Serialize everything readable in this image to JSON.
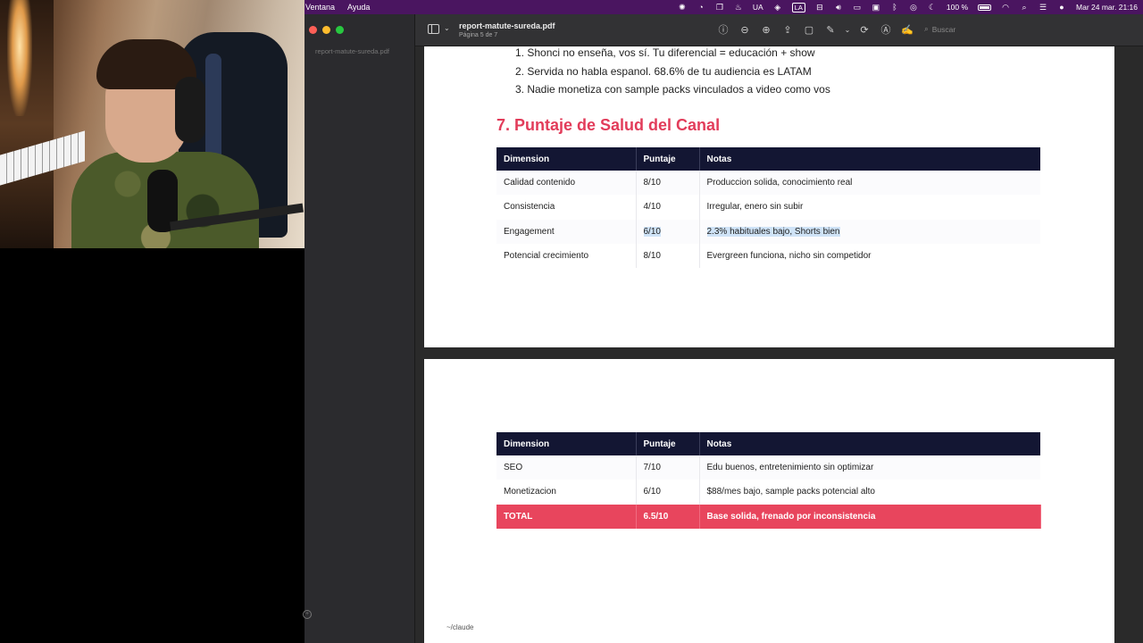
{
  "menubar": {
    "items": [
      "Ventana",
      "Ayuda"
    ],
    "status": {
      "input_source": "UA",
      "keyboard_badge": "LA",
      "battery": "100 %",
      "datetime": "Mar 24 mar.  21:16"
    }
  },
  "window": {
    "sidebar_thumb_label": "report-matute-sureda.pdf",
    "title": "report-matute-sureda.pdf",
    "subtitle": "Página 5 de 7",
    "search_placeholder": "Buscar"
  },
  "page5": {
    "list": [
      "1. Shonci no enseña, vos sí. Tu diferencial = educación + show",
      "2. Servida no habla espanol. 68.6% de tu audiencia es LATAM",
      "3. Nadie monetiza con sample packs vinculados a video como vos"
    ],
    "heading": "7. Puntaje de Salud del Canal",
    "table": {
      "headers": [
        "Dimension",
        "Puntaje",
        "Notas"
      ],
      "rows": [
        [
          "Calidad contenido",
          "8/10",
          "Produccion solida, conocimiento real"
        ],
        [
          "Consistencia",
          "4/10",
          "Irregular, enero sin subir"
        ],
        [
          "Engagement",
          "6/10",
          "2.3% habituales bajo, Shorts bien"
        ],
        [
          "Potencial crecimiento",
          "8/10",
          "Evergreen funciona, nicho sin competidor"
        ]
      ]
    }
  },
  "page6": {
    "table": {
      "headers": [
        "Dimension",
        "Puntaje",
        "Notas"
      ],
      "rows": [
        [
          "SEO",
          "7/10",
          "Edu buenos, entretenimiento sin optimizar"
        ],
        [
          "Monetizacion",
          "6/10",
          "$88/mes bajo, sample packs potencial alto"
        ]
      ],
      "total": [
        "TOTAL",
        "6.5/10",
        "Base solida, frenado por inconsistencia"
      ]
    }
  },
  "terminal_hint": "~/claude",
  "colors": {
    "heading": "#e23c5a",
    "table_header": "#131633",
    "total_row": "#e8455d",
    "menubar": "#4a1560"
  },
  "icons": [
    "sidebar-toggle-icon",
    "info-icon",
    "zoom-out-icon",
    "zoom-in-icon",
    "share-icon",
    "markup-icon",
    "rotate-icon",
    "annotate-icon",
    "signature-icon",
    "search-icon"
  ]
}
